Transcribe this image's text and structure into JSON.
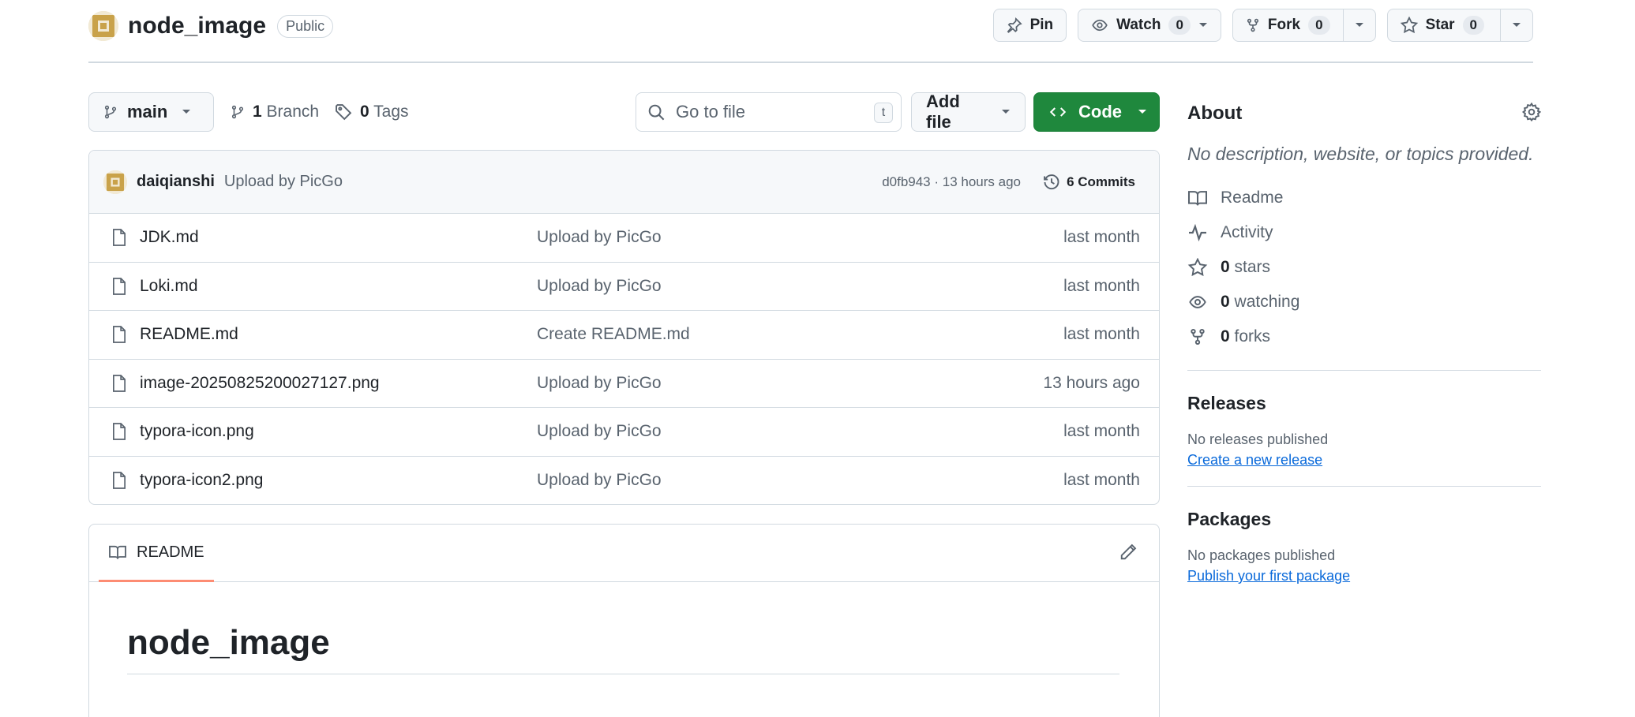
{
  "repo": {
    "name": "node_image",
    "visibility": "Public"
  },
  "header_actions": {
    "pin_label": "Pin",
    "watch_label": "Watch",
    "watch_count": "0",
    "fork_label": "Fork",
    "fork_count": "0",
    "star_label": "Star",
    "star_count": "0"
  },
  "toolbar": {
    "branch_name": "main",
    "branch_count": "1",
    "branch_label": "Branch",
    "tag_count": "0",
    "tag_label": "Tags",
    "search_placeholder": "Go to file",
    "search_shortcut": "t",
    "add_file_label": "Add file",
    "code_label": "Code"
  },
  "latest_commit": {
    "author": "daiqianshi",
    "message": "Upload by PicGo",
    "meta": "d0fb943 · 13 hours ago",
    "commits_label": "6 Commits"
  },
  "files": [
    {
      "name": "JDK.md",
      "message": "Upload by PicGo",
      "date": "last month"
    },
    {
      "name": "Loki.md",
      "message": "Upload by PicGo",
      "date": "last month"
    },
    {
      "name": "README.md",
      "message": "Create README.md",
      "date": "last month"
    },
    {
      "name": "image-20250825200027127.png",
      "message": "Upload by PicGo",
      "date": "13 hours ago"
    },
    {
      "name": "typora-icon.png",
      "message": "Upload by PicGo",
      "date": "last month"
    },
    {
      "name": "typora-icon2.png",
      "message": "Upload by PicGo",
      "date": "last month"
    }
  ],
  "readme": {
    "tab_label": "README",
    "heading": "node_image"
  },
  "about": {
    "title": "About",
    "description": "No description, website, or topics provided.",
    "readme_label": "Readme",
    "activity_label": "Activity",
    "stars_count": "0",
    "stars_label": "stars",
    "watching_count": "0",
    "watching_label": "watching",
    "forks_count": "0",
    "forks_label": "forks"
  },
  "releases": {
    "title": "Releases",
    "empty_text": "No releases published",
    "create_link": "Create a new release"
  },
  "packages": {
    "title": "Packages",
    "empty_text": "No packages published",
    "publish_link": "Publish your first package"
  },
  "colors": {
    "accent_green": "#1f883d",
    "link_blue": "#0969da",
    "border": "#d1d9e0",
    "muted_text": "#59636e",
    "tab_underline": "#fd8c73"
  },
  "icons": [
    "repo-avatar-icon",
    "pin-icon",
    "eye-icon",
    "repo-forked-icon",
    "star-icon",
    "triangle-down-icon",
    "git-branch-icon",
    "tag-icon",
    "search-icon",
    "code-icon",
    "history-icon",
    "file-icon",
    "book-icon",
    "pencil-icon",
    "gear-icon",
    "pulse-icon"
  ]
}
